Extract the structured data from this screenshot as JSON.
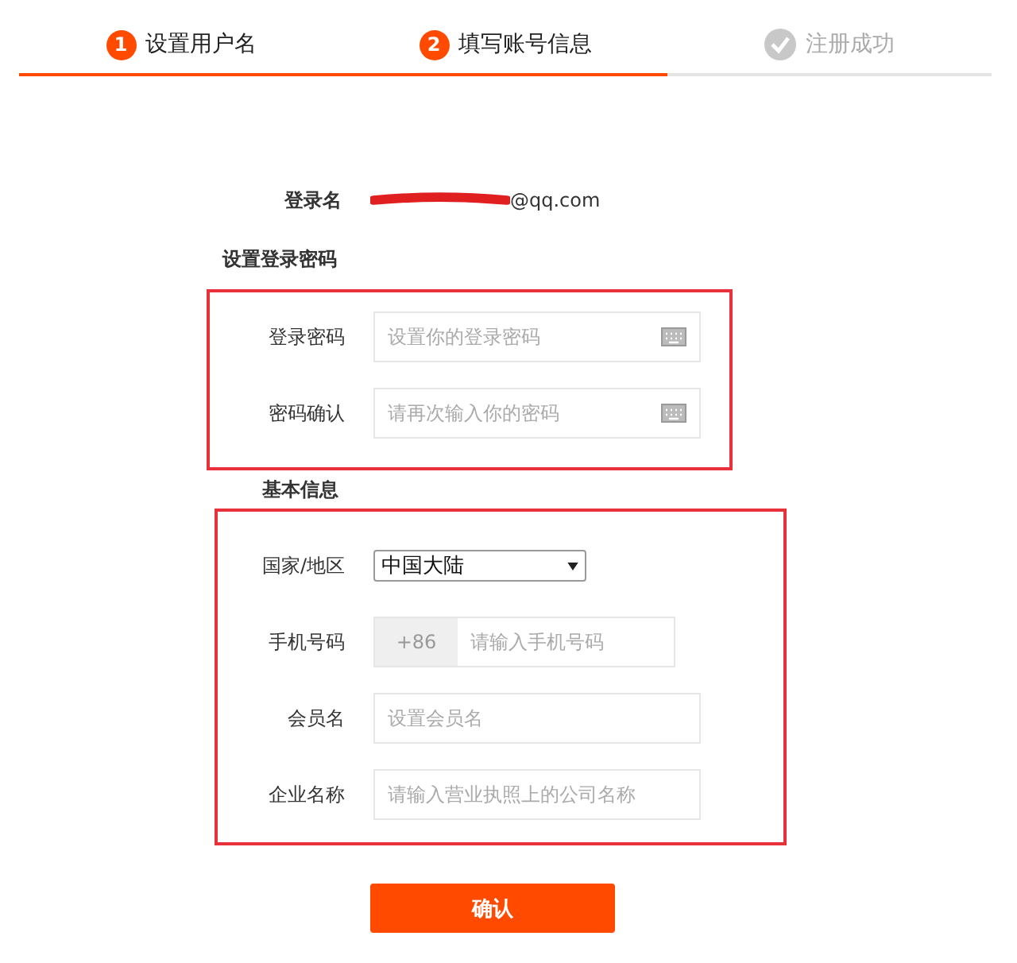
{
  "steps": [
    {
      "number": "1",
      "label": "设置用户名",
      "completed": true
    },
    {
      "number": "2",
      "label": "填写账号信息",
      "completed": true
    },
    {
      "label": "注册成功",
      "completed": false
    }
  ],
  "login_name": {
    "label": "登录名",
    "value": "@qq.com",
    "redacted": true
  },
  "sections": [
    {
      "title": "设置登录密码",
      "highlighted": true,
      "fields": [
        {
          "kind": "password",
          "label": "登录密码",
          "placeholder": "设置你的登录密码"
        },
        {
          "kind": "password",
          "label": "密码确认",
          "placeholder": "请再次输入你的密码"
        }
      ]
    },
    {
      "title": "基本信息",
      "highlighted": true,
      "fields": [
        {
          "kind": "select",
          "label": "国家/地区",
          "value": "中国大陆"
        },
        {
          "kind": "phone",
          "label": "手机号码",
          "prefix": "+86",
          "placeholder": "请输入手机号码"
        },
        {
          "kind": "text",
          "label": "会员名",
          "placeholder": "设置会员名"
        },
        {
          "kind": "text",
          "label": "企业名称",
          "placeholder": "请输入营业执照上的公司名称"
        }
      ]
    }
  ],
  "submit": "确认"
}
